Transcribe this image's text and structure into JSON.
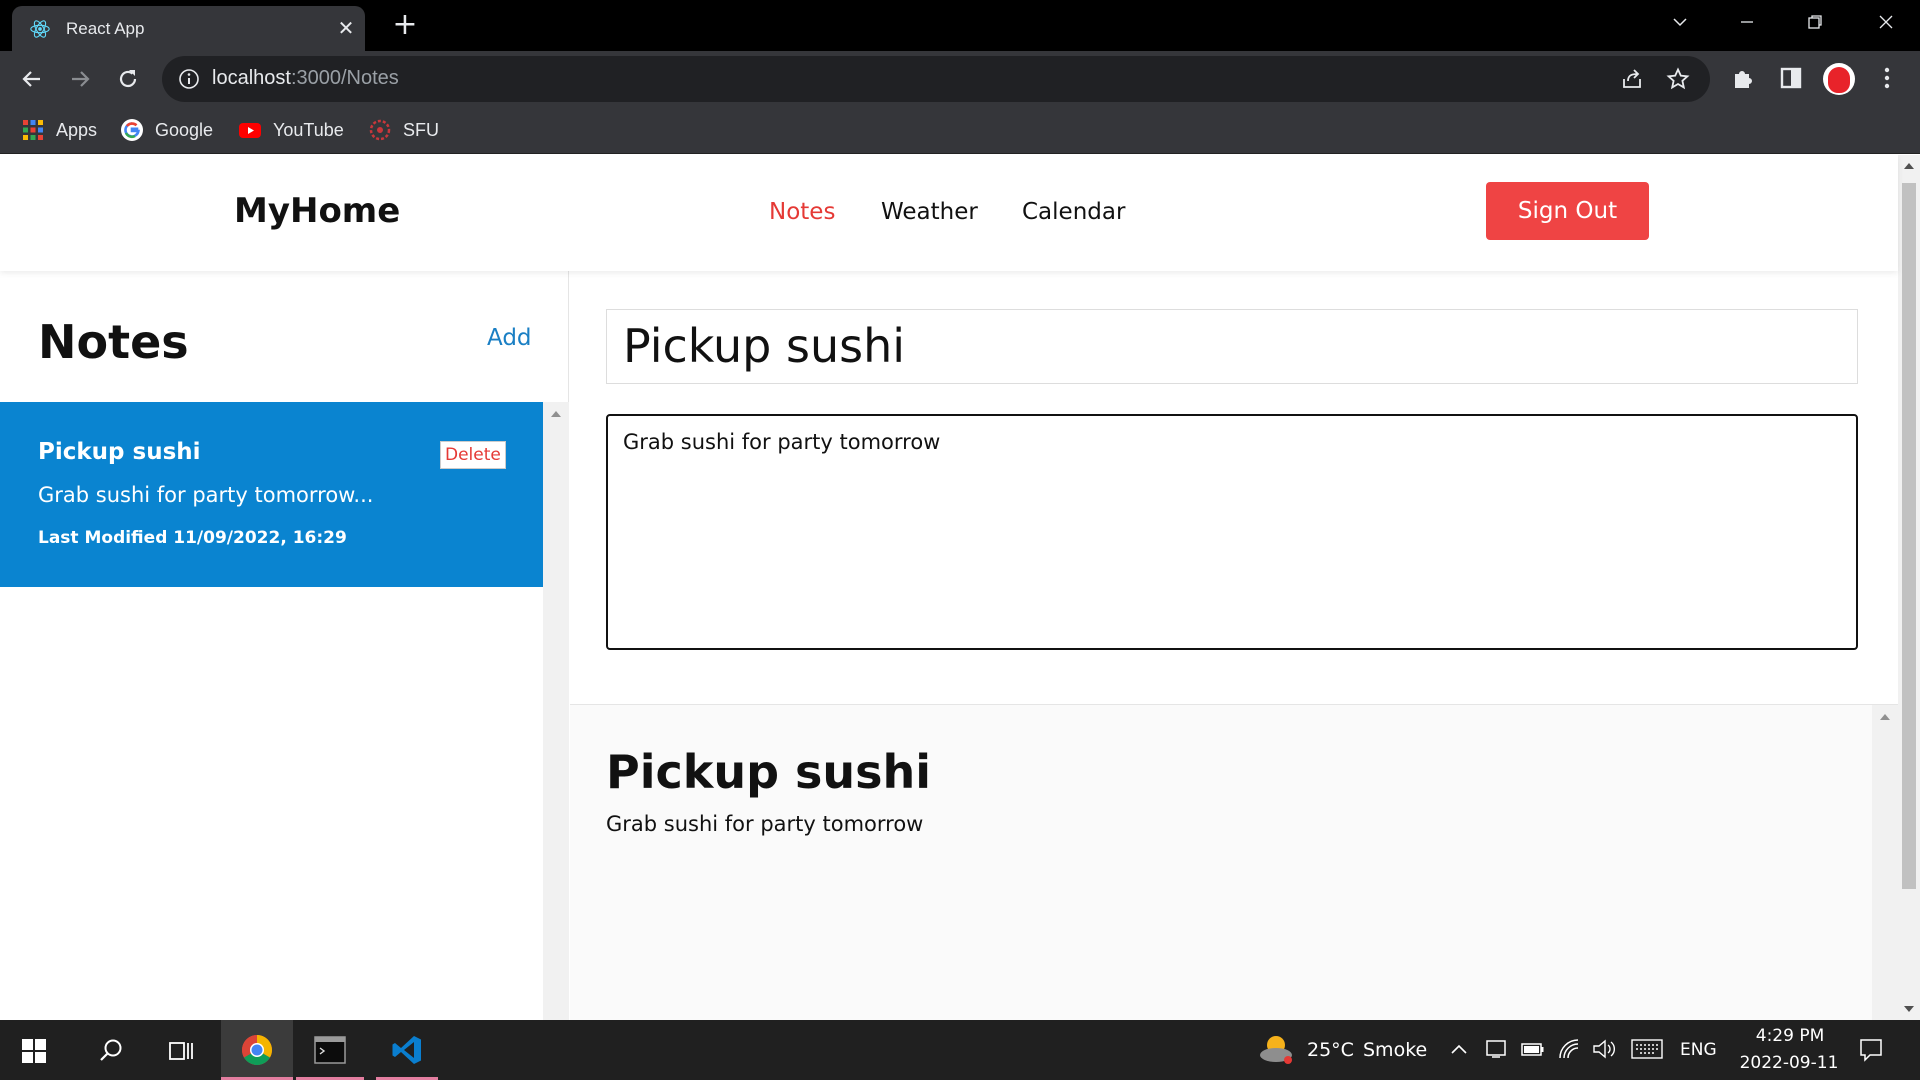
{
  "browser": {
    "tab_title": "React App",
    "url_host": "localhost",
    "url_path": ":3000/Notes",
    "bookmarks": [
      {
        "label": "Apps",
        "icon": "apps-grid-icon"
      },
      {
        "label": "Google",
        "icon": "google-icon"
      },
      {
        "label": "YouTube",
        "icon": "youtube-icon"
      },
      {
        "label": "SFU",
        "icon": "sfu-icon"
      }
    ]
  },
  "app": {
    "brand": "MyHome",
    "nav": [
      {
        "label": "Notes",
        "active": true
      },
      {
        "label": "Weather",
        "active": false
      },
      {
        "label": "Calendar",
        "active": false
      }
    ],
    "signout_label": "Sign Out",
    "accent_color": "#ef4444",
    "selected_color": "#0a84d0"
  },
  "sidebar": {
    "title": "Notes",
    "add_label": "Add",
    "notes": [
      {
        "title": "Pickup sushi",
        "preview": "Grab sushi for party tomorrow...",
        "meta": "Last Modified 11/09/2022, 16:29",
        "delete_label": "Delete"
      }
    ]
  },
  "editor": {
    "title_value": "Pickup sushi",
    "body_value": "Grab sushi for party tomorrow"
  },
  "preview": {
    "title": "Pickup sushi",
    "body": "Grab sushi for party tomorrow"
  },
  "taskbar": {
    "weather_temp": "25°C",
    "weather_desc": "Smoke",
    "language": "ENG",
    "time": "4:29 PM",
    "date": "2022-09-11"
  }
}
